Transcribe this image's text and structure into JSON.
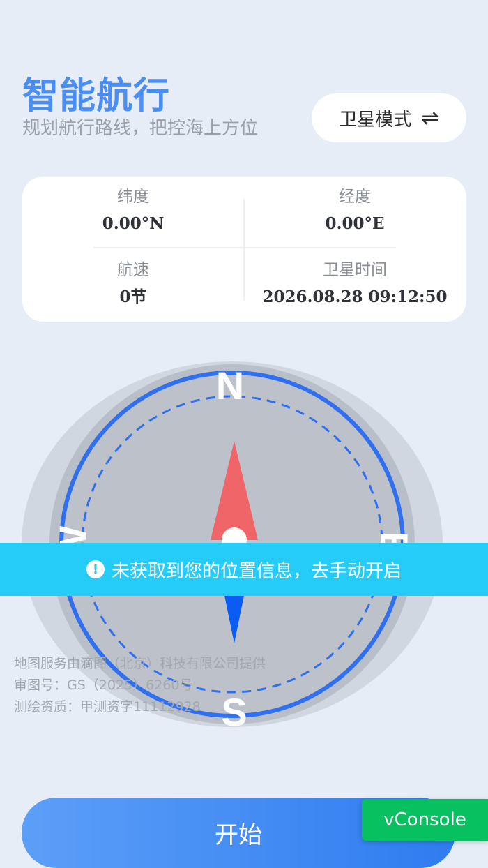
{
  "header": {
    "title": "智能航行",
    "subtitle": "规划航行路线，把控海上方位"
  },
  "mode_button": {
    "label": "卫星模式",
    "icon": "swap-arrows-icon",
    "swap_glyph": "⇌"
  },
  "info": {
    "latitude": {
      "label": "纬度",
      "value": "0.00°N"
    },
    "longitude": {
      "label": "经度",
      "value": "0.00°E"
    },
    "speed": {
      "label": "航速",
      "value": "0节"
    },
    "satellite_time": {
      "label": "卫星时间",
      "value": "2026.08.28 09:12:50"
    }
  },
  "compass": {
    "north": "N",
    "south": "S",
    "west": "W",
    "east": "E",
    "colors": {
      "ring": "#2f6ff0",
      "north_needle": "#f06567",
      "south_needle": "#0a5cf5"
    }
  },
  "banner": {
    "icon": "exclamation-icon",
    "icon_glyph": "!",
    "text": "未获取到您的位置信息，去手动开启",
    "color": "#26ccf8"
  },
  "map_credit": {
    "line1": "地图服务由滴图（北京）科技有限公司提供",
    "line2": "审图号：GS（2025）6260号",
    "line3": "测绘资质：甲测资字11112928"
  },
  "start_button": {
    "label": "开始"
  },
  "vconsole": {
    "label": "vConsole",
    "color": "#07c160"
  }
}
